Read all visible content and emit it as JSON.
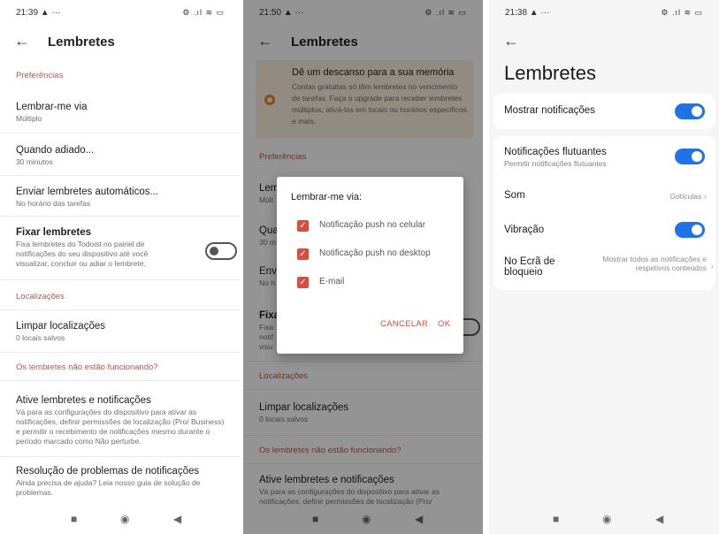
{
  "p1": {
    "status_time": "21:39 ▲ ···",
    "status_icons": "⚙ .ıl ≋ ▭",
    "title": "Lembretes",
    "sec_preferences": "Preferências",
    "remind_via": {
      "title": "Lembrar-me via",
      "sub": "Múltiplo"
    },
    "snooze": {
      "title": "Quando adiado...",
      "sub": "30 minutos"
    },
    "auto": {
      "title": "Enviar lembretes automáticos...",
      "sub": "No horário das tarefas"
    },
    "pin": {
      "title": "Fixar lembretes",
      "sub": "Fixa lembretes do Todoist no painel de notificações do seu dispositivo até você visualizar, concluir ou adiar o lembrete."
    },
    "sec_locations": "Localizações",
    "clear": {
      "title": "Limpar localizações",
      "sub": "0 locais salvos"
    },
    "sec_not_working": "Os lembretes não estão funcionando?",
    "enable": {
      "title": "Ative lembretes e notificações",
      "sub": "Vá para as configurações do dispositivo para ativar as notificações, definir permissões de localização (Pro/ Business) e permitir o recebimento de notificações mesmo durante o período marcado como Não perturbe."
    },
    "troubleshoot": {
      "title": "Resolução de problemas de notificações",
      "sub": "Ainda precisa de ajuda? Leia nosso guia de solução de problemas."
    },
    "pin_toggle_on": false
  },
  "p2": {
    "status_time": "21:50 ▲ ···",
    "status_icons": "⚙ .ıl ≋ ▭",
    "title": "Lembretes",
    "promo_title": "Dê um descanso para a sua memória",
    "promo_body": "Contas gratuitas só têm lembretes no vencimento de tarefas. Faça o upgrade para receber lembretes múltiplos, ativá-los em locais ou horários específicos e mais.",
    "sec_preferences": "Preferências",
    "rem_frag": {
      "title": "Lem",
      "sub": "Múlt"
    },
    "qua_frag": {
      "title": "Qua",
      "sub": "30 m"
    },
    "env_frag": {
      "title": "Env",
      "sub": "No h"
    },
    "fix_frag": {
      "title": "Fixa",
      "sub": "Fixa notif visu"
    },
    "sec_locations": "Localizações",
    "clear": {
      "title": "Limpar localizações",
      "sub": "0 locais salvos"
    },
    "sec_not_working": "Os lembretes não estão funcionando?",
    "enable": {
      "title": "Ative lembretes e notificações",
      "sub": "Vá para as configurações do dispositivo para ativar as notificações, definir permissões de localização (Pro/"
    },
    "dialog": {
      "title": "Lembrar-me via:",
      "options": [
        {
          "label": "Notificação push no celular",
          "checked": true
        },
        {
          "label": "Notificação push no desktop",
          "checked": true
        },
        {
          "label": "E-mail",
          "checked": true
        }
      ],
      "cancel": "CANCELAR",
      "ok": "OK",
      "check_glyph": "✓"
    }
  },
  "p3": {
    "status_time": "21:38 ▲ ···",
    "status_icons": "⚙ .ıl ≋ ▭",
    "title": "Lembretes",
    "show_notifications": "Mostrar notificações",
    "floating": {
      "title": "Notificações flutuantes",
      "sub": "Permitir notificações flutuantes"
    },
    "sound": {
      "title": "Som",
      "value": "Gotículas"
    },
    "vibration": "Vibração",
    "lockscreen": {
      "title": "No Ecrã de bloqueio",
      "value": "Mostrar todos as notificações e respetivos conteúdos"
    }
  },
  "nav": {
    "recents": "■",
    "home": "◉",
    "back": "◀"
  },
  "icons": {
    "back_arrow": "←",
    "chevron_right": "›"
  },
  "colors": {
    "accent_red": "#db4c3f",
    "toggle_blue": "#1f73e8",
    "promo_bg": "#fcefe1",
    "promo_icon": "#e8862a"
  }
}
